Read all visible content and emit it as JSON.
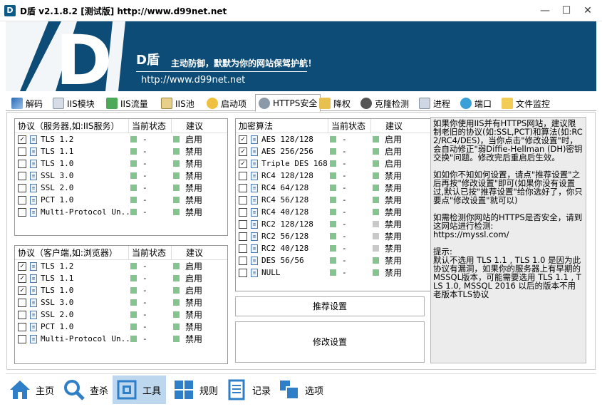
{
  "window": {
    "title": "D盾 v2.1.8.2 [测试版] http://www.d99net.net"
  },
  "banner": {
    "logo": "D",
    "brand": "D盾",
    "slogan": "主动防御，默默为你的网站保驾护航！",
    "url": "http://www.d99net.net"
  },
  "tabs": [
    {
      "label": "解码",
      "icon": "decode-icon"
    },
    {
      "label": "IIS模块",
      "icon": "module-icon"
    },
    {
      "label": "IIS流量",
      "icon": "traffic-icon"
    },
    {
      "label": "IIS池",
      "icon": "pool-icon"
    },
    {
      "label": "启动项",
      "icon": "startup-icon"
    },
    {
      "label": "HTTPS安全",
      "icon": "https-icon",
      "active": true
    },
    {
      "label": "降权",
      "icon": "demote-icon"
    },
    {
      "label": "克隆检测",
      "icon": "clone-icon"
    },
    {
      "label": "进程",
      "icon": "process-icon"
    },
    {
      "label": "端口",
      "icon": "port-icon"
    },
    {
      "label": "文件监控",
      "icon": "folder-icon"
    }
  ],
  "server_protocols": {
    "headers": [
      "协议（服务器,如:IIS服务）",
      "当前状态",
      "建议"
    ],
    "rows": [
      {
        "checked": true,
        "name": "TLS 1.2",
        "status": "-",
        "suggest": "启用",
        "state": "on",
        "sug_state": "on"
      },
      {
        "checked": false,
        "name": "TLS 1.1",
        "status": "-",
        "suggest": "禁用",
        "state": "on",
        "sug_state": "on"
      },
      {
        "checked": false,
        "name": "TLS 1.0",
        "status": "-",
        "suggest": "禁用",
        "state": "on",
        "sug_state": "on"
      },
      {
        "checked": false,
        "name": "SSL 3.0",
        "status": "-",
        "suggest": "禁用",
        "state": "on",
        "sug_state": "on"
      },
      {
        "checked": false,
        "name": "SSL 2.0",
        "status": "-",
        "suggest": "禁用",
        "state": "on",
        "sug_state": "on"
      },
      {
        "checked": false,
        "name": "PCT 1.0",
        "status": "-",
        "suggest": "禁用",
        "state": "on",
        "sug_state": "on"
      },
      {
        "checked": false,
        "name": "Multi-Protocol Un...",
        "status": "-",
        "suggest": "禁用",
        "state": "on",
        "sug_state": "on"
      }
    ]
  },
  "client_protocols": {
    "headers": [
      "协议（客户端,如:浏览器）",
      "当前状态",
      "建议"
    ],
    "rows": [
      {
        "checked": true,
        "name": "TLS 1.2",
        "status": "-",
        "suggest": "启用",
        "state": "on",
        "sug_state": "on"
      },
      {
        "checked": true,
        "name": "TLS 1.1",
        "status": "-",
        "suggest": "启用",
        "state": "on",
        "sug_state": "on"
      },
      {
        "checked": true,
        "name": "TLS 1.0",
        "status": "-",
        "suggest": "启用",
        "state": "on",
        "sug_state": "on"
      },
      {
        "checked": false,
        "name": "SSL 3.0",
        "status": "-",
        "suggest": "禁用",
        "state": "on",
        "sug_state": "on"
      },
      {
        "checked": false,
        "name": "SSL 2.0",
        "status": "-",
        "suggest": "禁用",
        "state": "on",
        "sug_state": "on"
      },
      {
        "checked": false,
        "name": "PCT 1.0",
        "status": "-",
        "suggest": "禁用",
        "state": "on",
        "sug_state": "on"
      },
      {
        "checked": false,
        "name": "Multi-Protocol Un...",
        "status": "-",
        "suggest": "禁用",
        "state": "on",
        "sug_state": "on"
      }
    ]
  },
  "ciphers": {
    "headers": [
      "加密算法",
      "当前状态",
      "建议"
    ],
    "rows": [
      {
        "checked": true,
        "name": "AES 128/128",
        "status": "-",
        "suggest": "启用",
        "state": "on",
        "sug_state": "on"
      },
      {
        "checked": true,
        "name": "AES 256/256",
        "status": "-",
        "suggest": "启用",
        "state": "on",
        "sug_state": "on"
      },
      {
        "checked": true,
        "name": "Triple DES 168",
        "status": "-",
        "suggest": "启用",
        "state": "on",
        "sug_state": "on"
      },
      {
        "checked": false,
        "name": "RC4 128/128",
        "status": "-",
        "suggest": "禁用",
        "state": "on",
        "sug_state": "on"
      },
      {
        "checked": false,
        "name": "RC4 64/128",
        "status": "-",
        "suggest": "禁用",
        "state": "on",
        "sug_state": "on"
      },
      {
        "checked": false,
        "name": "RC4 56/128",
        "status": "-",
        "suggest": "禁用",
        "state": "on",
        "sug_state": "on"
      },
      {
        "checked": false,
        "name": "RC4 40/128",
        "status": "-",
        "suggest": "禁用",
        "state": "on",
        "sug_state": "on"
      },
      {
        "checked": false,
        "name": "RC2 128/128",
        "status": "-",
        "suggest": "禁用",
        "state": "on",
        "sug_state": "off"
      },
      {
        "checked": false,
        "name": "RC2 56/128",
        "status": "-",
        "suggest": "禁用",
        "state": "on",
        "sug_state": "off"
      },
      {
        "checked": false,
        "name": "RC2 40/128",
        "status": "-",
        "suggest": "禁用",
        "state": "on",
        "sug_state": "off"
      },
      {
        "checked": false,
        "name": "DES 56/56",
        "status": "-",
        "suggest": "禁用",
        "state": "on",
        "sug_state": "on"
      },
      {
        "checked": false,
        "name": "NULL",
        "status": "-",
        "suggest": "禁用",
        "state": "on",
        "sug_state": "on"
      }
    ]
  },
  "buttons": {
    "recommend": "推荐设置",
    "modify": "修改设置"
  },
  "info_text": "如果你使用IIS并有HTTPS网站，建议限制老旧的协议(如:SSL,PCT)和算法(如:RC2/RC4/DES)，当你点击\"修改设置\"时，会自动修正\"弱Diffie-Hellman (DH)密钥交换\"问题。修改完后重启后生效。\n\n如如你不知如何设置，请点\"推荐设置\"之后再按\"修改设置\"即可(如果你没有设置过,默认已按\"推荐设置\"给你选好了，你只要点\"修改设置\"就可以)\n\n如需检测你网站的HTTPS是否安全，请到这网站进行检测:\nhttps://myssl.com/\n\n提示:\n默认不选用 TLS 1.1 , TLS 1.0 是因为此协议有漏洞，如果你的服务器上有早期的MSSQL版本，可能需要选用 TLS 1.1 , TLS 1.0, MSSQL 2016 以后的版本不用老版本TLS协议",
  "bottom_nav": [
    {
      "label": "主页",
      "icon": "home-icon"
    },
    {
      "label": "查杀",
      "icon": "search-icon"
    },
    {
      "label": "工具",
      "icon": "tools-icon",
      "active": true
    },
    {
      "label": "规则",
      "icon": "grid-icon"
    },
    {
      "label": "记录",
      "icon": "log-icon"
    },
    {
      "label": "选项",
      "icon": "options-icon"
    }
  ],
  "colors": {
    "banner": "#0c4c76",
    "status_on": "#84c48e",
    "status_off": "#c9c9c9",
    "nav_active": "#bcd7ee"
  }
}
